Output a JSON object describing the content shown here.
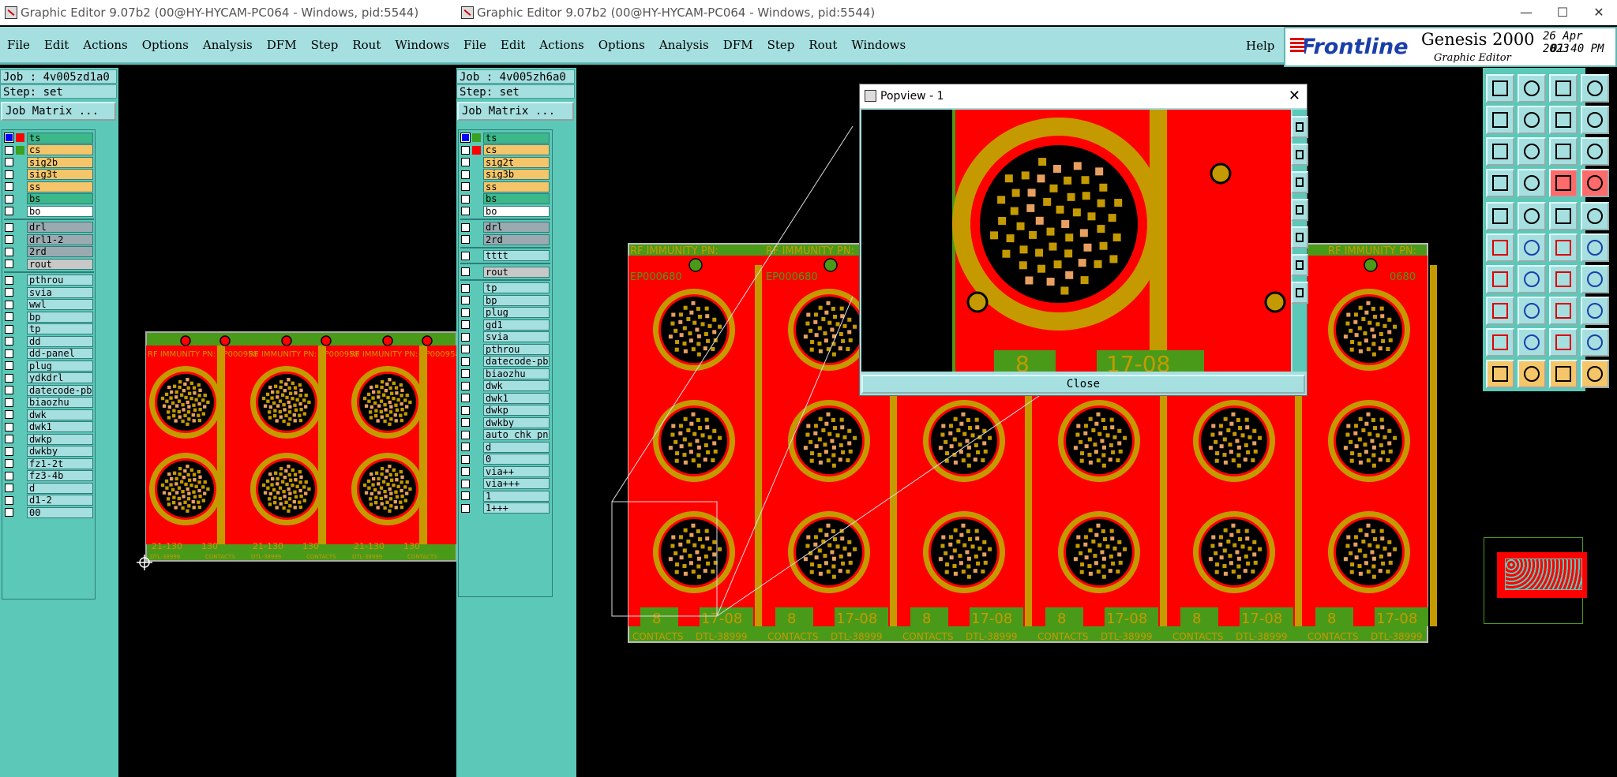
{
  "left_window": {
    "title": "Graphic Editor 9.07b2 (00@HY-HYCAM-PC064 - Windows, pid:5544)",
    "menu": [
      "File",
      "Edit",
      "Actions",
      "Options",
      "Analysis",
      "DFM",
      "Step",
      "Rout",
      "Windows",
      "He"
    ],
    "job": "Job : 4v005zd1a0",
    "step": "Step: set",
    "job_matrix": "Job Matrix ...",
    "layers": [
      "ts",
      "cs",
      "sig2b",
      "sig3t",
      "ss",
      "bs",
      "bo",
      "drl",
      "drl1-2",
      "2rd",
      "rout",
      "pthrou",
      "svia",
      "wwl",
      "bp",
      "tp",
      "dd",
      "dd-panel",
      "plug",
      "ydkdrl",
      "datecode-pbe",
      "biaozhu",
      "dwk",
      "dwk1",
      "dwkp",
      "dwkby",
      "fz1-2t",
      "fz3-4b",
      "d",
      "d1-2",
      "00"
    ],
    "board_text": [
      "RF IMMUNITY PN: EP000958",
      "RF IMMUNITY PN: EP000958",
      "RF IMMUNITY PN: EP000958",
      "21-130",
      "130",
      "21-130",
      "130",
      "21-130",
      "130",
      "DTL-38999",
      "CONTACTS",
      "DTL-38999",
      "CONTACTS",
      "DTL-38999",
      "CONTACTS"
    ]
  },
  "right_window": {
    "title": "Graphic Editor 9.07b2 (00@HY-HYCAM-PC064 - Windows, pid:5544)",
    "menu": [
      "File",
      "Edit",
      "Actions",
      "Options",
      "Analysis",
      "DFM",
      "Step",
      "Rout",
      "Windows"
    ],
    "help": "Help",
    "brand": "Frontline",
    "product": "Genesis 2000",
    "subtitle": "Graphic Editor",
    "date": "26 Apr 2023",
    "time": "01:40 PM",
    "job": "Job : 4v005zh6a0",
    "step": "Step: set",
    "job_matrix": "Job Matrix ...",
    "layers": [
      "ts",
      "cs",
      "sig2t",
      "sig3b",
      "ss",
      "bs",
      "bo",
      "drl",
      "2rd",
      "tttt",
      "rout",
      "tp",
      "bp",
      "plug",
      "gd1",
      "svia",
      "pthrou",
      "datecode-pbe",
      "biaozhu",
      "dwk",
      "dwk1",
      "dwkp",
      "dwkby",
      "auto_chk_pn",
      "d",
      "0",
      "via++",
      "via+++",
      "1",
      "1+++"
    ],
    "board_text": [
      "RF IMMUNITY PN:",
      "RF IMMUNITY PN:",
      "RF IMMUNITY PN:",
      "EP000680",
      "EP000680",
      "0680",
      "8",
      "17-08",
      "CONTACTS",
      "DTL-38999"
    ]
  },
  "popview": {
    "title": "Popview - 1",
    "close_label": "Close",
    "board_text": [
      "8",
      "17-08"
    ]
  },
  "colors": {
    "panel": "#5cc8b8",
    "menu": "#a6dfe0",
    "board_red": "#ff0000",
    "board_gold": "#c49a00",
    "board_green": "#4a9a1a"
  }
}
